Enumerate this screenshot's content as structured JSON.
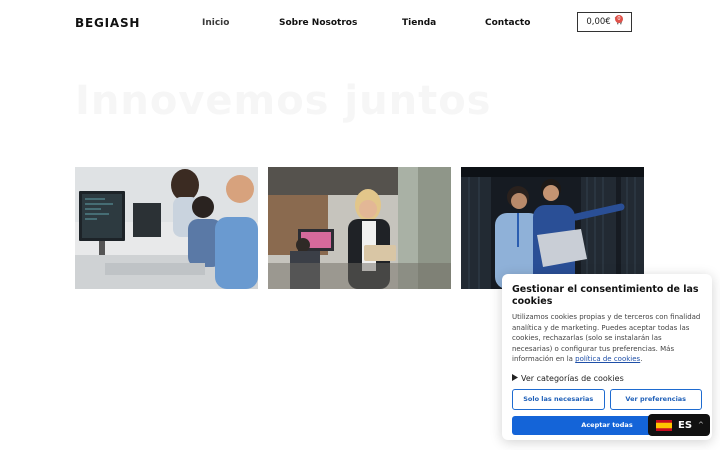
{
  "header": {
    "logo": "BEGIASH",
    "nav": [
      {
        "label": "Inicio",
        "active": true
      },
      {
        "label": "Sobre Nosotros"
      },
      {
        "label": "Tienda"
      },
      {
        "label": "Contacto"
      }
    ],
    "cart": {
      "total": "0,00€",
      "count": "0",
      "icon": "cart-icon"
    }
  },
  "hero": {
    "title": "Innovemos juntos"
  },
  "photos": [
    {
      "alt": "team-at-computers"
    },
    {
      "alt": "woman-with-tablet-office"
    },
    {
      "alt": "engineers-in-server-room"
    }
  ],
  "cookie_banner": {
    "title": "Gestionar el consentimiento de las cookies",
    "text": "Utilizamos cookies propias y de terceros con finalidad analítica y de marketing. Puedes aceptar todas las cookies, rechazarlas (solo se instalarán las necesarias) o configurar tus preferencias. Más información en la",
    "link": "política de cookies",
    "link_suffix": ".",
    "categories_toggle": "Ver categorías de cookies",
    "btn_necessary": "Solo las necesarias",
    "btn_preferences": "Ver preferencias",
    "btn_accept": "Aceptar todas"
  },
  "language": {
    "code": "ES",
    "icon": "spain-flag-icon"
  },
  "colors": {
    "accent": "#1464d8",
    "badge": "#e0524a"
  }
}
